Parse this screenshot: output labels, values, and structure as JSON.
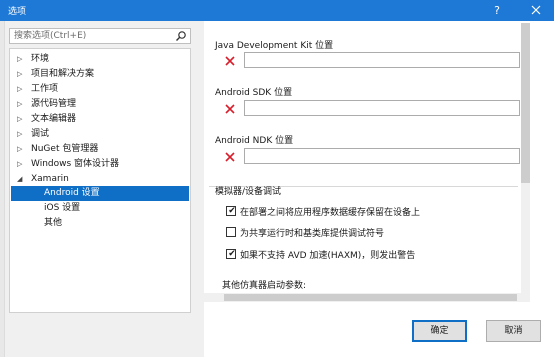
{
  "window": {
    "title": "选项",
    "help_label": "?"
  },
  "search": {
    "placeholder": "搜索选项(Ctrl+E)"
  },
  "tree": {
    "items": [
      {
        "label": "环境",
        "arrow": "▷"
      },
      {
        "label": "项目和解决方案",
        "arrow": "▷"
      },
      {
        "label": "工作项",
        "arrow": "▷"
      },
      {
        "label": "源代码管理",
        "arrow": "▷"
      },
      {
        "label": "文本编辑器",
        "arrow": "▷"
      },
      {
        "label": "调试",
        "arrow": "▷"
      },
      {
        "label": "NuGet 包管理器",
        "arrow": "▷"
      },
      {
        "label": "Windows 窗体设计器",
        "arrow": "▷"
      },
      {
        "label": "Xamarin",
        "arrow": "◢"
      },
      {
        "label": "Android 设置"
      },
      {
        "label": "iOS 设置"
      },
      {
        "label": "其他"
      }
    ],
    "selected": "Android 设置"
  },
  "sdk": {
    "jdk_label": "Java Development Kit 位置",
    "jdk_value": "",
    "android_sdk_label": "Android SDK 位置",
    "android_sdk_value": "",
    "android_ndk_label": "Android NDK 位置",
    "android_ndk_value": ""
  },
  "emulator": {
    "group_title": "模拟器/设备调试",
    "options": [
      {
        "label": "在部署之间将应用程序数据缓存保留在设备上",
        "checked": true
      },
      {
        "label": "为共享运行时和基类库提供调试符号",
        "checked": false
      },
      {
        "label": "如果不支持 AVD 加速(HAXM)，则发出警告",
        "checked": true
      }
    ],
    "args_label": "其他仿真器启动参数:"
  },
  "buttons": {
    "ok": "确定",
    "cancel": "取消"
  },
  "colors": {
    "titlebar": "#1e79d6",
    "selection": "#0f6ec5",
    "error_x": "#d7202e"
  },
  "icons": {
    "search": "search-icon",
    "close": "close-icon",
    "error": "error-x-icon"
  }
}
